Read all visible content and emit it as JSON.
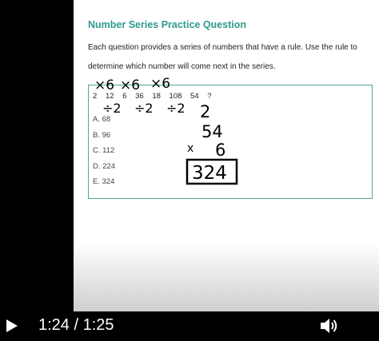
{
  "slide": {
    "title": "Number Series Practice Question",
    "description": "Each question provides a series of numbers that have a rule. Use the rule to determine which number will come next in the series.",
    "series": [
      "2",
      "12",
      "6",
      "36",
      "18",
      "108",
      "54",
      "?"
    ],
    "options": [
      "A. 68",
      "B. 96",
      "C. 112",
      "D. 224",
      "E. 324"
    ],
    "annotations": {
      "multipliers": [
        "×6",
        "×6",
        "×6"
      ],
      "dividers": [
        "÷2",
        "÷2",
        "÷2"
      ],
      "work": [
        "2",
        "54",
        "x",
        "6",
        "324"
      ]
    }
  },
  "player": {
    "time": "1:24 / 1:25",
    "accent": "#2f9a8f"
  },
  "icons": {
    "play": "play-icon",
    "volume": "volume-icon"
  }
}
